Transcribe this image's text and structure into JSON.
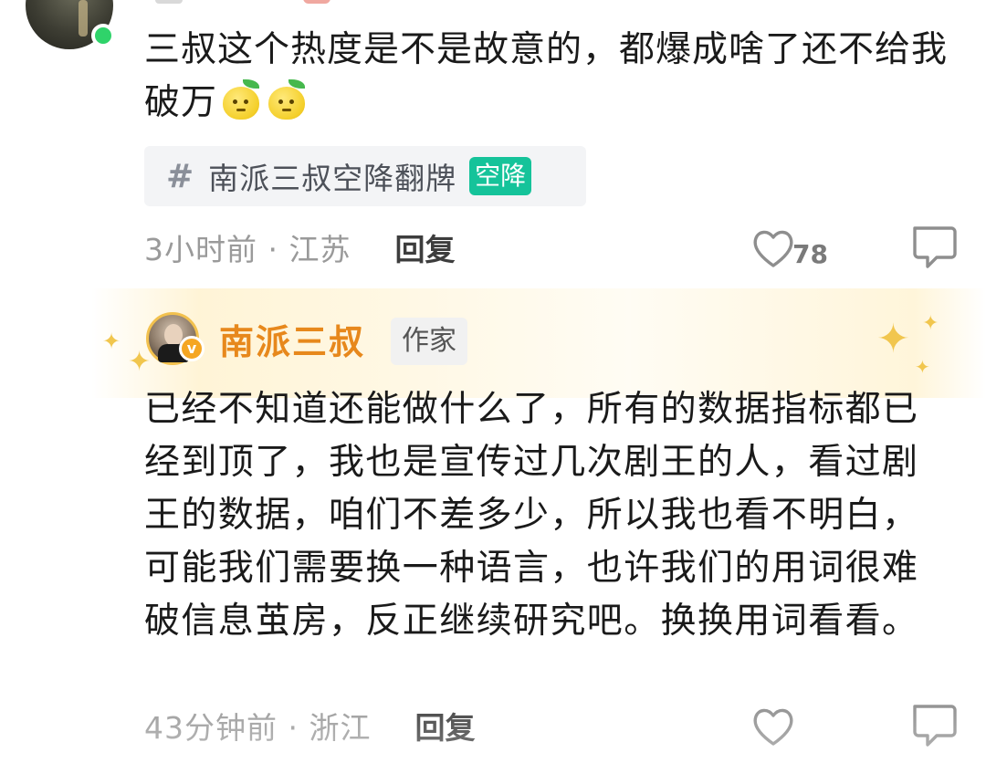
{
  "comments": [
    {
      "text": "三叔这个热度是不是故意的，都爆成啥了还不给我破万",
      "emojis": [
        "lemon-emoji",
        "lemon-emoji"
      ],
      "topic": {
        "hash": "#",
        "label": "南派三叔空降翻牌",
        "badge": "空降"
      },
      "time_location": "3小时前 · 江苏",
      "reply_label": "回复",
      "likes": "78",
      "online": true
    },
    {
      "author": {
        "name": "南派三叔",
        "tag": "作家",
        "verified_badge": "v"
      },
      "text": "已经不知道还能做什么了，所有的数据指标都已经到顶了，我也是宣传过几次剧王的人，看过剧王的数据，咱们不差多少，所以我也看不明白，可能我们需要换一种语言，也许我们的用词很难破信息茧房，反正继续研究吧。换换用词看看。",
      "time_location": "43分钟前 · 浙江",
      "reply_label": "回复"
    }
  ],
  "colors": {
    "author_name": "#e7881c",
    "topic_badge": "#15c39a",
    "online_dot": "#2fd36a",
    "meta_text": "#9a9a9a"
  }
}
